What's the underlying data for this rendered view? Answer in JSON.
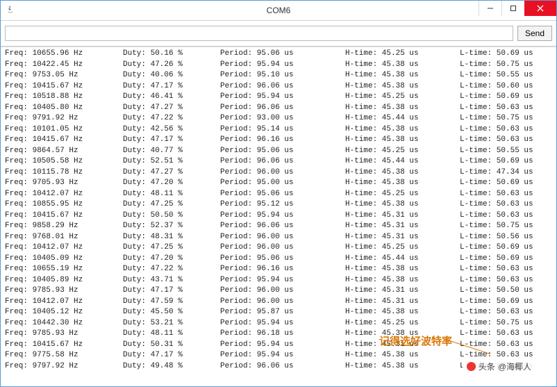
{
  "window": {
    "title": "COM6"
  },
  "toolbar": {
    "send_label": "Send",
    "input_value": ""
  },
  "annotation": "记得选好波特率",
  "watermark": {
    "prefix": "头条",
    "user": "@海椰人"
  },
  "columns": {
    "freq": "Freq:",
    "duty": "Duty:",
    "period": "Period:",
    "htime": "H-time:",
    "ltime": "L-time:"
  },
  "rows": [
    {
      "freq": "10655.96 Hz",
      "duty": "50.16 %",
      "period": "95.06 us",
      "htime": "45.25 us",
      "ltime": "50.69 us"
    },
    {
      "freq": "10422.45 Hz",
      "duty": "47.26 %",
      "period": "95.94 us",
      "htime": "45.38 us",
      "ltime": "50.75 us"
    },
    {
      "freq": "9753.05 Hz",
      "duty": "40.06 %",
      "period": "95.10 us",
      "htime": "45.38 us",
      "ltime": "50.55 us"
    },
    {
      "freq": "10415.67 Hz",
      "duty": "47.17 %",
      "period": "96.06 us",
      "htime": "45.38 us",
      "ltime": "50.60 us"
    },
    {
      "freq": "10518.88 Hz",
      "duty": "46.41 %",
      "period": "95.94 us",
      "htime": "45.25 us",
      "ltime": "50.69 us"
    },
    {
      "freq": "10405.80 Hz",
      "duty": "47.27 %",
      "period": "96.06 us",
      "htime": "45.38 us",
      "ltime": "50.63 us"
    },
    {
      "freq": "9791.92 Hz",
      "duty": "47.22 %",
      "period": "93.00 us",
      "htime": "45.44 us",
      "ltime": "50.75 us"
    },
    {
      "freq": "10101.05 Hz",
      "duty": "42.56 %",
      "period": "95.14 us",
      "htime": "45.38 us",
      "ltime": "50.63 us"
    },
    {
      "freq": "10415.67 Hz",
      "duty": "47.17 %",
      "period": "96.16 us",
      "htime": "45.38 us",
      "ltime": "50.63 us"
    },
    {
      "freq": "9864.57 Hz",
      "duty": "40.77 %",
      "period": "95.06 us",
      "htime": "45.25 us",
      "ltime": "50.55 us"
    },
    {
      "freq": "10505.58 Hz",
      "duty": "52.51 %",
      "period": "96.06 us",
      "htime": "45.44 us",
      "ltime": "50.69 us"
    },
    {
      "freq": "10115.78 Hz",
      "duty": "47.27 %",
      "period": "96.00 us",
      "htime": "45.38 us",
      "ltime": "47.34 us"
    },
    {
      "freq": "9705.93 Hz",
      "duty": "47.20 %",
      "period": "95.00 us",
      "htime": "45.38 us",
      "ltime": "50.69 us"
    },
    {
      "freq": "10412.07 Hz",
      "duty": "48.11 %",
      "period": "95.06 us",
      "htime": "45.25 us",
      "ltime": "50.63 us"
    },
    {
      "freq": "10855.95 Hz",
      "duty": "47.25 %",
      "period": "95.12 us",
      "htime": "45.38 us",
      "ltime": "50.63 us"
    },
    {
      "freq": "10415.67 Hz",
      "duty": "50.50 %",
      "period": "95.94 us",
      "htime": "45.31 us",
      "ltime": "50.63 us"
    },
    {
      "freq": "9858.29 Hz",
      "duty": "52.37 %",
      "period": "96.06 us",
      "htime": "45.31 us",
      "ltime": "50.75 us"
    },
    {
      "freq": "9768.01 Hz",
      "duty": "48.31 %",
      "period": "96.00 us",
      "htime": "45.31 us",
      "ltime": "50.56 us"
    },
    {
      "freq": "10412.07 Hz",
      "duty": "47.25 %",
      "period": "96.00 us",
      "htime": "45.25 us",
      "ltime": "50.69 us"
    },
    {
      "freq": "10405.09 Hz",
      "duty": "47.20 %",
      "period": "95.06 us",
      "htime": "45.44 us",
      "ltime": "50.69 us"
    },
    {
      "freq": "10655.19 Hz",
      "duty": "47.22 %",
      "period": "96.16 us",
      "htime": "45.38 us",
      "ltime": "50.63 us"
    },
    {
      "freq": "10405.89 Hz",
      "duty": "43.71 %",
      "period": "95.94 us",
      "htime": "45.38 us",
      "ltime": "50.63 us"
    },
    {
      "freq": "9785.93 Hz",
      "duty": "47.17 %",
      "period": "96.00 us",
      "htime": "45.31 us",
      "ltime": "50.50 us"
    },
    {
      "freq": "10412.07 Hz",
      "duty": "47.59 %",
      "period": "96.00 us",
      "htime": "45.31 us",
      "ltime": "50.69 us"
    },
    {
      "freq": "10405.12 Hz",
      "duty": "45.50 %",
      "period": "95.87 us",
      "htime": "45.38 us",
      "ltime": "50.63 us"
    },
    {
      "freq": "10442.30 Hz",
      "duty": "53.21 %",
      "period": "95.94 us",
      "htime": "45.25 us",
      "ltime": "50.75 us"
    },
    {
      "freq": "9785.93 Hz",
      "duty": "48.11 %",
      "period": "96.18 us",
      "htime": "45.38 us",
      "ltime": "50.63 us"
    },
    {
      "freq": "10415.67 Hz",
      "duty": "50.31 %",
      "period": "95.94 us",
      "htime": "45.31 us",
      "ltime": "50.63 us"
    },
    {
      "freq": "9775.58 Hz",
      "duty": "47.17 %",
      "period": "95.94 us",
      "htime": "45.38 us",
      "ltime": "50.63 us"
    },
    {
      "freq": "9797.92 Hz",
      "duty": "49.48 %",
      "period": "96.06 us",
      "htime": "45.38 us",
      "ltime": "50.69 us"
    }
  ]
}
